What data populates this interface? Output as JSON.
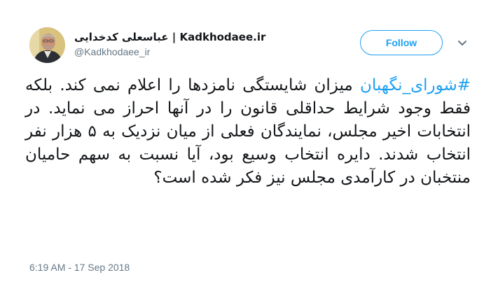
{
  "author": {
    "display_name": "عباسعلی کدخدایی | Kadkhodaee.ir",
    "handle": "@Kadkhodaee_ir",
    "avatar_icon": "profile-photo"
  },
  "follow_button": {
    "label": "Follow"
  },
  "menu_caret_icon": "chevron-down-icon",
  "tweet": {
    "hashtag": "#شورای_نگهبان",
    "body": " میزان شایستگی نامزدها را اعلام نمی کند. بلکه فقط وجود شرایط حداقلی قانون را در آنها احراز می نماید. در انتخابات اخیر مجلس، نمایندگان فعلی از میان نزدیک به ۵ هزار نفر انتخاب شدند. دایره انتخاب وسیع بود، آیا نسبت به سهم حامیان منتخبان در کارآمدی مجلس نیز فکر شده است؟",
    "timestamp": "6:19 AM - 17 Sep 2018"
  },
  "colors": {
    "accent": "#1da1f2",
    "text": "#14171a",
    "secondary": "#657786"
  }
}
